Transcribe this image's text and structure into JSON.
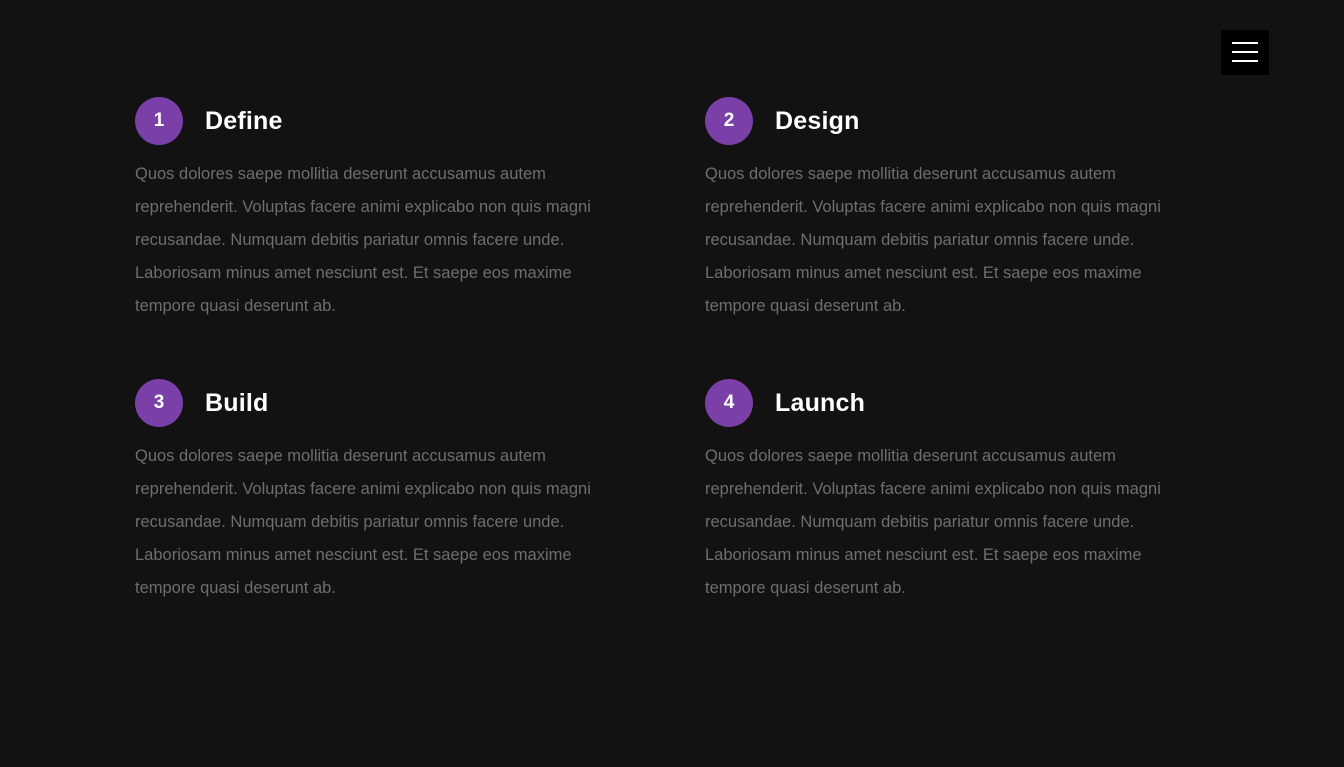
{
  "menu": {
    "icon": "hamburger-menu-icon"
  },
  "steps": [
    {
      "number": "1",
      "title": "Define",
      "text": "Quos dolores saepe mollitia deserunt accusamus autem reprehenderit. Voluptas facere animi explicabo non quis magni recusandae. Numquam debitis pariatur omnis facere unde. Laboriosam minus amet nesciunt est. Et saepe eos maxime tempore quasi deserunt ab."
    },
    {
      "number": "2",
      "title": "Design",
      "text": "Quos dolores saepe mollitia deserunt accusamus autem reprehenderit. Voluptas facere animi explicabo non quis magni recusandae. Numquam debitis pariatur omnis facere unde. Laboriosam minus amet nesciunt est. Et saepe eos maxime tempore quasi deserunt ab."
    },
    {
      "number": "3",
      "title": "Build",
      "text": "Quos dolores saepe mollitia deserunt accusamus autem reprehenderit. Voluptas facere animi explicabo non quis magni recusandae. Numquam debitis pariatur omnis facere unde. Laboriosam minus amet nesciunt est. Et saepe eos maxime tempore quasi deserunt ab."
    },
    {
      "number": "4",
      "title": "Launch",
      "text": "Quos dolores saepe mollitia deserunt accusamus autem reprehenderit. Voluptas facere animi explicabo non quis magni recusandae. Numquam debitis pariatur omnis facere unde. Laboriosam minus amet nesciunt est. Et saepe eos maxime tempore quasi deserunt ab."
    }
  ],
  "colors": {
    "background": "#121212",
    "accent": "#7b3fa8",
    "title": "#ffffff",
    "body_text": "#6e6e6e",
    "menu_background": "#000000"
  }
}
